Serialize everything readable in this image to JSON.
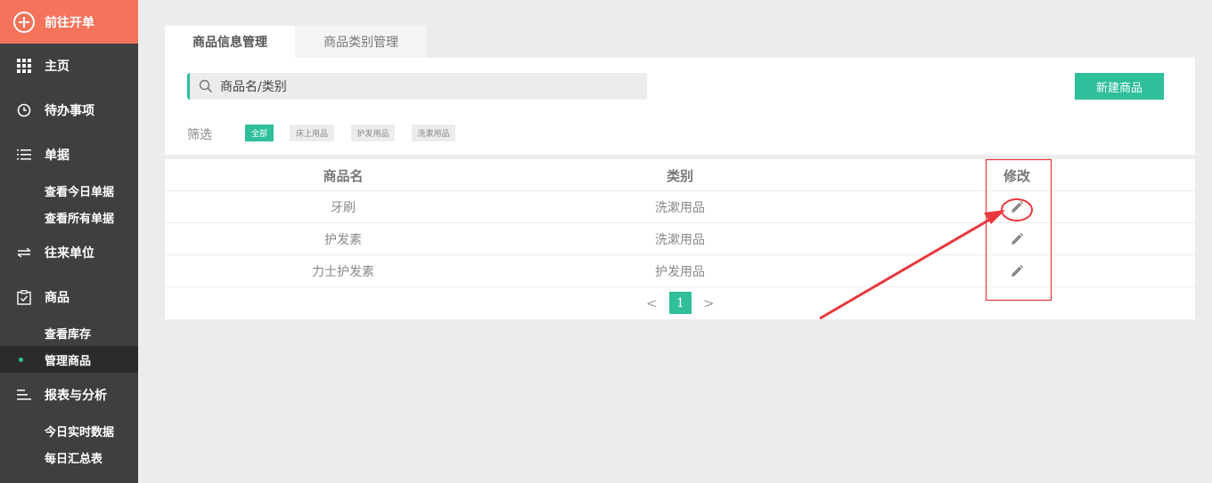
{
  "sidebar": {
    "new_order": "前往开单",
    "items": [
      {
        "label": "主页",
        "icon": "grid-icon"
      },
      {
        "label": "待办事项",
        "icon": "clock-icon"
      },
      {
        "label": "单据",
        "icon": "list-icon"
      },
      {
        "label": "往来单位",
        "icon": "swap-arrows-icon"
      },
      {
        "label": "商品",
        "icon": "clipboard-check-icon"
      },
      {
        "label": "报表与分析",
        "icon": "bars-icon"
      }
    ],
    "sub": {
      "documents": [
        "查看今日单据",
        "查看所有单据"
      ],
      "goods": [
        "查看库存",
        "管理商品"
      ],
      "reports": [
        "今日实时数据",
        "每日汇总表"
      ]
    }
  },
  "tabs": [
    "商品信息管理",
    "商品类别管理"
  ],
  "search": {
    "placeholder": "商品名/类别"
  },
  "new_button": "新建商品",
  "filter": {
    "label": "筛选",
    "options": [
      "全部",
      "床上用品",
      "护发用品",
      "洗漱用品"
    ],
    "selected": "全部"
  },
  "table": {
    "headers": [
      "商品名",
      "类别",
      "修改"
    ],
    "rows": [
      {
        "name": "牙刷",
        "category": "洗漱用品"
      },
      {
        "name": "护发素",
        "category": "洗漱用品"
      },
      {
        "name": "力士护发素",
        "category": "护发用品"
      }
    ]
  },
  "pager": {
    "prev": "<",
    "current": "1",
    "next": ">"
  },
  "colors": {
    "accent": "#2fbf9a",
    "brand": "#f3735b",
    "sidebar": "#3f3f3f",
    "annotation": "#e8383d"
  }
}
